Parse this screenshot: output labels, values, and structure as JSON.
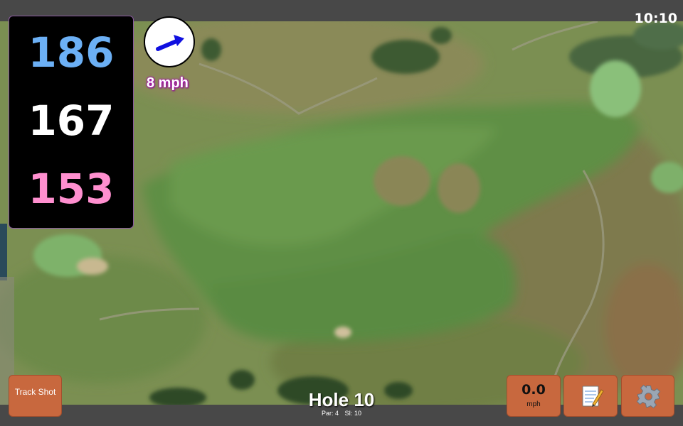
{
  "status_bar": {
    "time": "10:10"
  },
  "distances": {
    "back": "186",
    "middle": "167",
    "front": "153"
  },
  "wind": {
    "speed_label": "8 mph",
    "direction_icon": "arrow-icon",
    "arrow_color": "#1010e0"
  },
  "hole": {
    "title": "Hole 10",
    "par_label": "Par: 4",
    "si_label": "SI: 10"
  },
  "buttons": {
    "track_shot": "Track Shot",
    "speed_value": "0.0",
    "speed_unit": "mph",
    "notes_icon": "notepad-icon",
    "settings_icon": "gear-icon"
  },
  "colors": {
    "back_distance": "#6cb0f5",
    "middle_distance": "#ffffff",
    "front_distance": "#ff8fcf",
    "button_bg": "#c8683e"
  }
}
